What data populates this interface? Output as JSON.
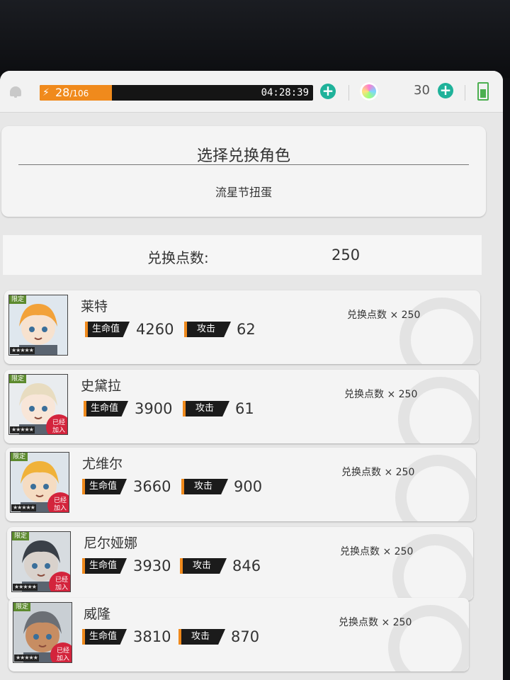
{
  "status_bar": {
    "energy": "28",
    "energy_max": "/106",
    "energy_fraction": 0.264,
    "timer": "04:28:39",
    "gems": "30",
    "add_symbol": "+"
  },
  "header": {
    "title": "选择兑换角色",
    "subtitle": "流星节扭蛋"
  },
  "points": {
    "label": "兑换点数:",
    "value": "250"
  },
  "labels": {
    "hp": "生命值",
    "atk": "攻击",
    "limited": "限定",
    "stars": "★★★★★",
    "joined_line1": "已经",
    "joined_line2": "加入"
  },
  "characters": [
    {
      "name": "莱特",
      "hp": "4260",
      "atk": "62",
      "cost": "兑换点数 × 250",
      "joined": false
    },
    {
      "name": "史黛拉",
      "hp": "3900",
      "atk": "61",
      "cost": "兑换点数 × 250",
      "joined": true
    },
    {
      "name": "尤维尔",
      "hp": "3660",
      "atk": "900",
      "cost": "兑换点数 × 250",
      "joined": true
    },
    {
      "name": "尼尔娅娜",
      "hp": "3930",
      "atk": "846",
      "cost": "兑换点数 × 250",
      "joined": true
    },
    {
      "name": "威隆",
      "hp": "3810",
      "atk": "870",
      "cost": "兑换点数 × 250",
      "joined": true
    }
  ],
  "colors": {
    "accent_orange": "#f08a1c",
    "accent_teal": "#1fb29a",
    "joined_red": "#d3243c"
  }
}
